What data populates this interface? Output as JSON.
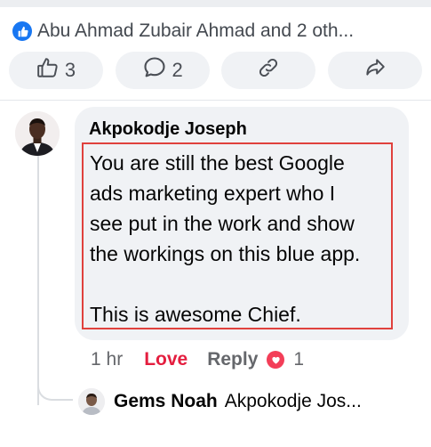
{
  "post": {
    "reactions_summary": "Abu Ahmad Zubair Ahmad and 2 oth..."
  },
  "actions": {
    "like_count": "3",
    "comment_count": "2"
  },
  "comment": {
    "author": "Akpokodje Joseph",
    "lines": [
      "You are still the best Google",
      "ads marketing expert who I",
      "see put in the work and show",
      "the workings on this blue app."
    ],
    "closing": "This is awesome Chief.",
    "time": "1 hr",
    "reaction_label": "Love",
    "reply_label": "Reply",
    "reaction_count": "1"
  },
  "reply": {
    "author": "Gems Noah",
    "preview": "Akpokodje Jos..."
  },
  "colors": {
    "facebook_blue": "#1877f2",
    "love_red": "#e41e3f",
    "highlight_border": "#e0413d"
  },
  "icons": [
    "like-icon",
    "thumbs-up-icon",
    "comment-icon",
    "link-icon",
    "share-icon",
    "heart-icon"
  ]
}
